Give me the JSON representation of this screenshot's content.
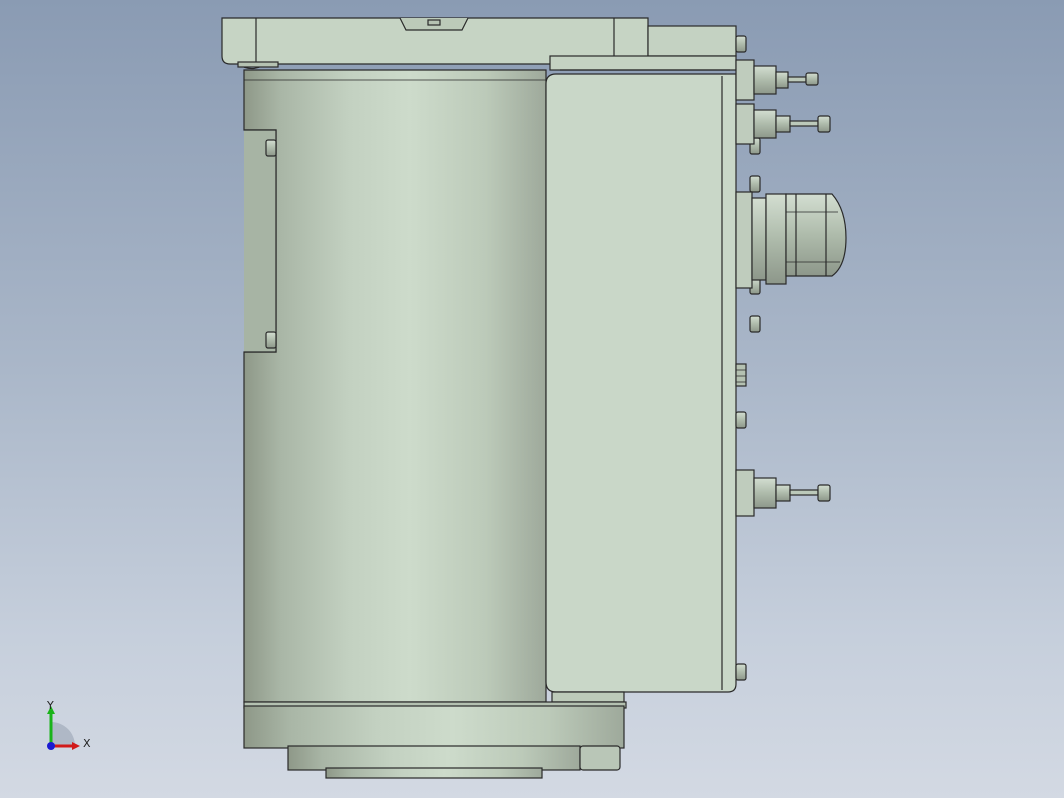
{
  "viewport": {
    "background_top": "#8a9bb3",
    "background_bottom": "#d3d9e3",
    "model_color": "#c7d6c6",
    "edge_color": "#2a2a2a"
  },
  "triad": {
    "x_label": "X",
    "y_label": "Y",
    "x_color": "#d11a1a",
    "y_color": "#19b319",
    "z_color": "#1a1ad1"
  }
}
